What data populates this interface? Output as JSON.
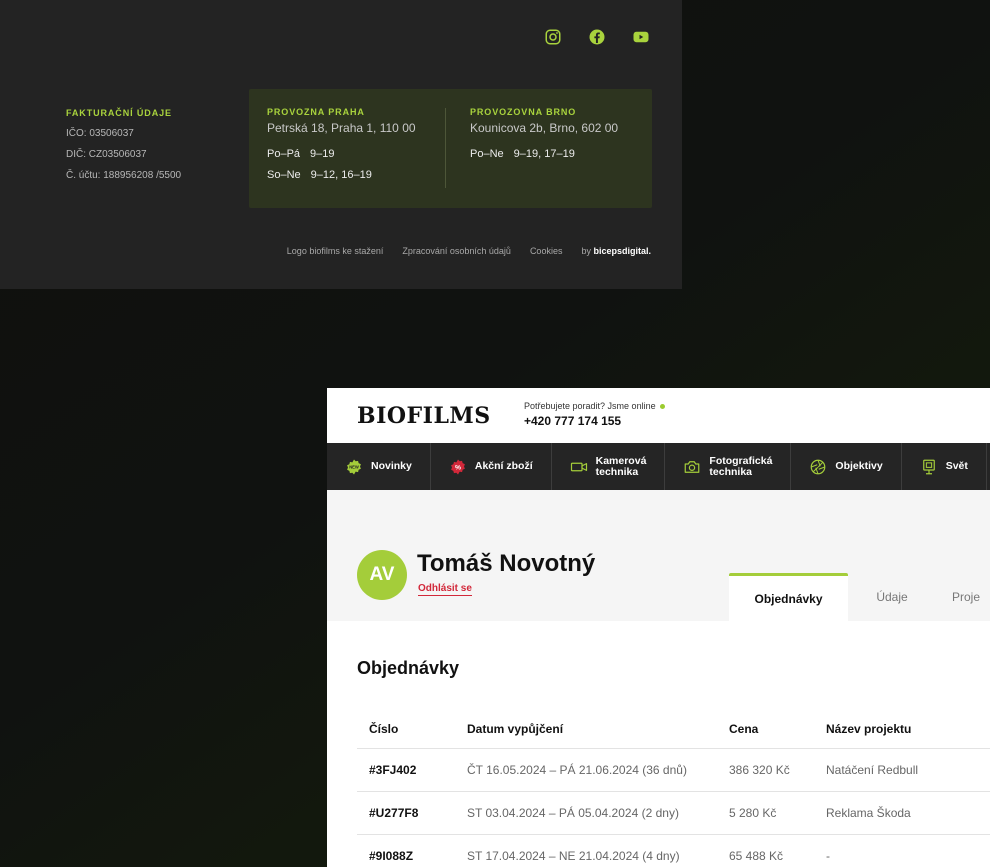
{
  "footer": {
    "social": [
      {
        "icon": "instagram-icon"
      },
      {
        "icon": "facebook-icon"
      },
      {
        "icon": "youtube-icon"
      }
    ],
    "billing": {
      "heading": "FAKTURAČNÍ ÚDAJE",
      "lines": [
        "IČO: 03506037",
        "DIČ: CZ03506037",
        "Č. účtu: 188956208 /5500"
      ]
    },
    "branches": [
      {
        "heading": "PROVOZNA PRAHA",
        "address": "Petrská 18, Praha 1, 110 00",
        "hours": [
          {
            "days": "Po–Pá",
            "time": "9–19"
          },
          {
            "days": "So–Ne",
            "time": "9–12, 16–19"
          }
        ]
      },
      {
        "heading": "PROVOZOVNA BRNO",
        "address": "Kounicova 2b, Brno, 602 00",
        "hours": [
          {
            "days": "Po–Ne",
            "time": "9–19, 17–19"
          }
        ]
      }
    ],
    "links": [
      "Logo biofilms ke stažení",
      "Zpracování osobních údajů",
      "Cookies"
    ],
    "credit_prefix": "by",
    "credit_name": "bicepsdigital."
  },
  "header": {
    "logo": "BIOFILMS",
    "help_text": "Potřebujete poradit? Jsme online",
    "phone": "+420 777 174 155"
  },
  "nav": [
    {
      "label": "Novinky",
      "icon": "new-badge-icon"
    },
    {
      "label": "Akční zboží",
      "icon": "discount-icon"
    },
    {
      "label": "Kamerová\ntechnika",
      "icon": "video-camera-icon"
    },
    {
      "label": "Fotografická\ntechnika",
      "icon": "photo-camera-icon"
    },
    {
      "label": "Objektivy",
      "icon": "aperture-icon"
    },
    {
      "label": "Svět",
      "icon": "light-panel-icon"
    }
  ],
  "profile": {
    "initials": "AV",
    "name": "Tomáš Novotný",
    "logout": "Odhlásit se"
  },
  "tabs": {
    "orders": "Objednávky",
    "details": "Údaje",
    "projects": "Proje"
  },
  "orders": {
    "heading": "Objednávky",
    "columns": [
      "Číslo",
      "Datum vypůjčení",
      "Cena",
      "Název projektu"
    ],
    "rows": [
      {
        "id": "#3FJ402",
        "date": "ČT 16.05.2024 – PÁ 21.06.2024 (36 dnů)",
        "price": "386 320 Kč",
        "project": "Natáčení Redbull"
      },
      {
        "id": "#U277F8",
        "date": "ST 03.04.2024 – PÁ 05.04.2024 (2 dny)",
        "price": "5 280 Kč",
        "project": "Reklama Škoda"
      },
      {
        "id": "#9I088Z",
        "date": "ST 17.04.2024 – NE 21.04.2024 (4 dny)",
        "price": "65 488 Kč",
        "project": "-"
      }
    ]
  },
  "colors": {
    "accent": "#a4cd3a",
    "logout": "#d2283a",
    "footer_bg": "#232323",
    "nav_bg": "#252525"
  }
}
